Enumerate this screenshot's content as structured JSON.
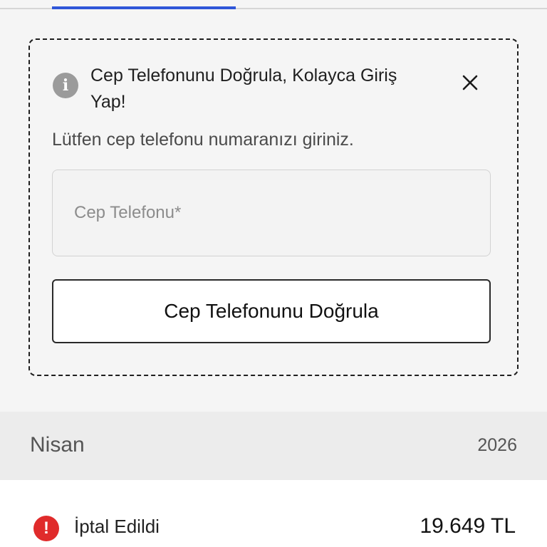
{
  "verify_card": {
    "info_icon": "info-icon",
    "title": "Cep Telefonunu Doğrula, Kolayca Giriş Yap!",
    "close_icon": "close-icon",
    "subtitle": "Lütfen cep telefonu numaranızı giriniz.",
    "phone_input": {
      "value": "",
      "placeholder": "Cep Telefonu*"
    },
    "verify_button_label": "Cep Telefonunu Doğrula"
  },
  "month_header": {
    "month": "Nisan",
    "year": "2026"
  },
  "order": {
    "status_icon": "alert-icon",
    "status_color": "#e02b2b",
    "status": "İptal Edildi",
    "amount": "19.649 TL"
  },
  "colors": {
    "accent": "#2f56d8"
  }
}
